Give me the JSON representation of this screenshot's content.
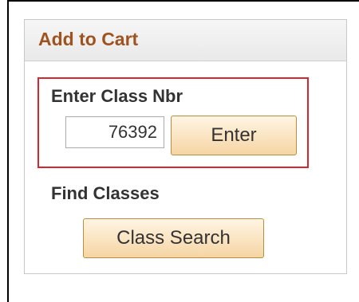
{
  "panel": {
    "title": "Add to Cart"
  },
  "enter_class": {
    "label": "Enter Class Nbr",
    "class_number": "76392",
    "enter_button": "Enter"
  },
  "find_classes": {
    "label": "Find Classes",
    "search_button": "Class Search"
  },
  "colors": {
    "title": "#a1531f",
    "highlight_border": "#d8262d",
    "button_bg": "#f6d5a4"
  }
}
